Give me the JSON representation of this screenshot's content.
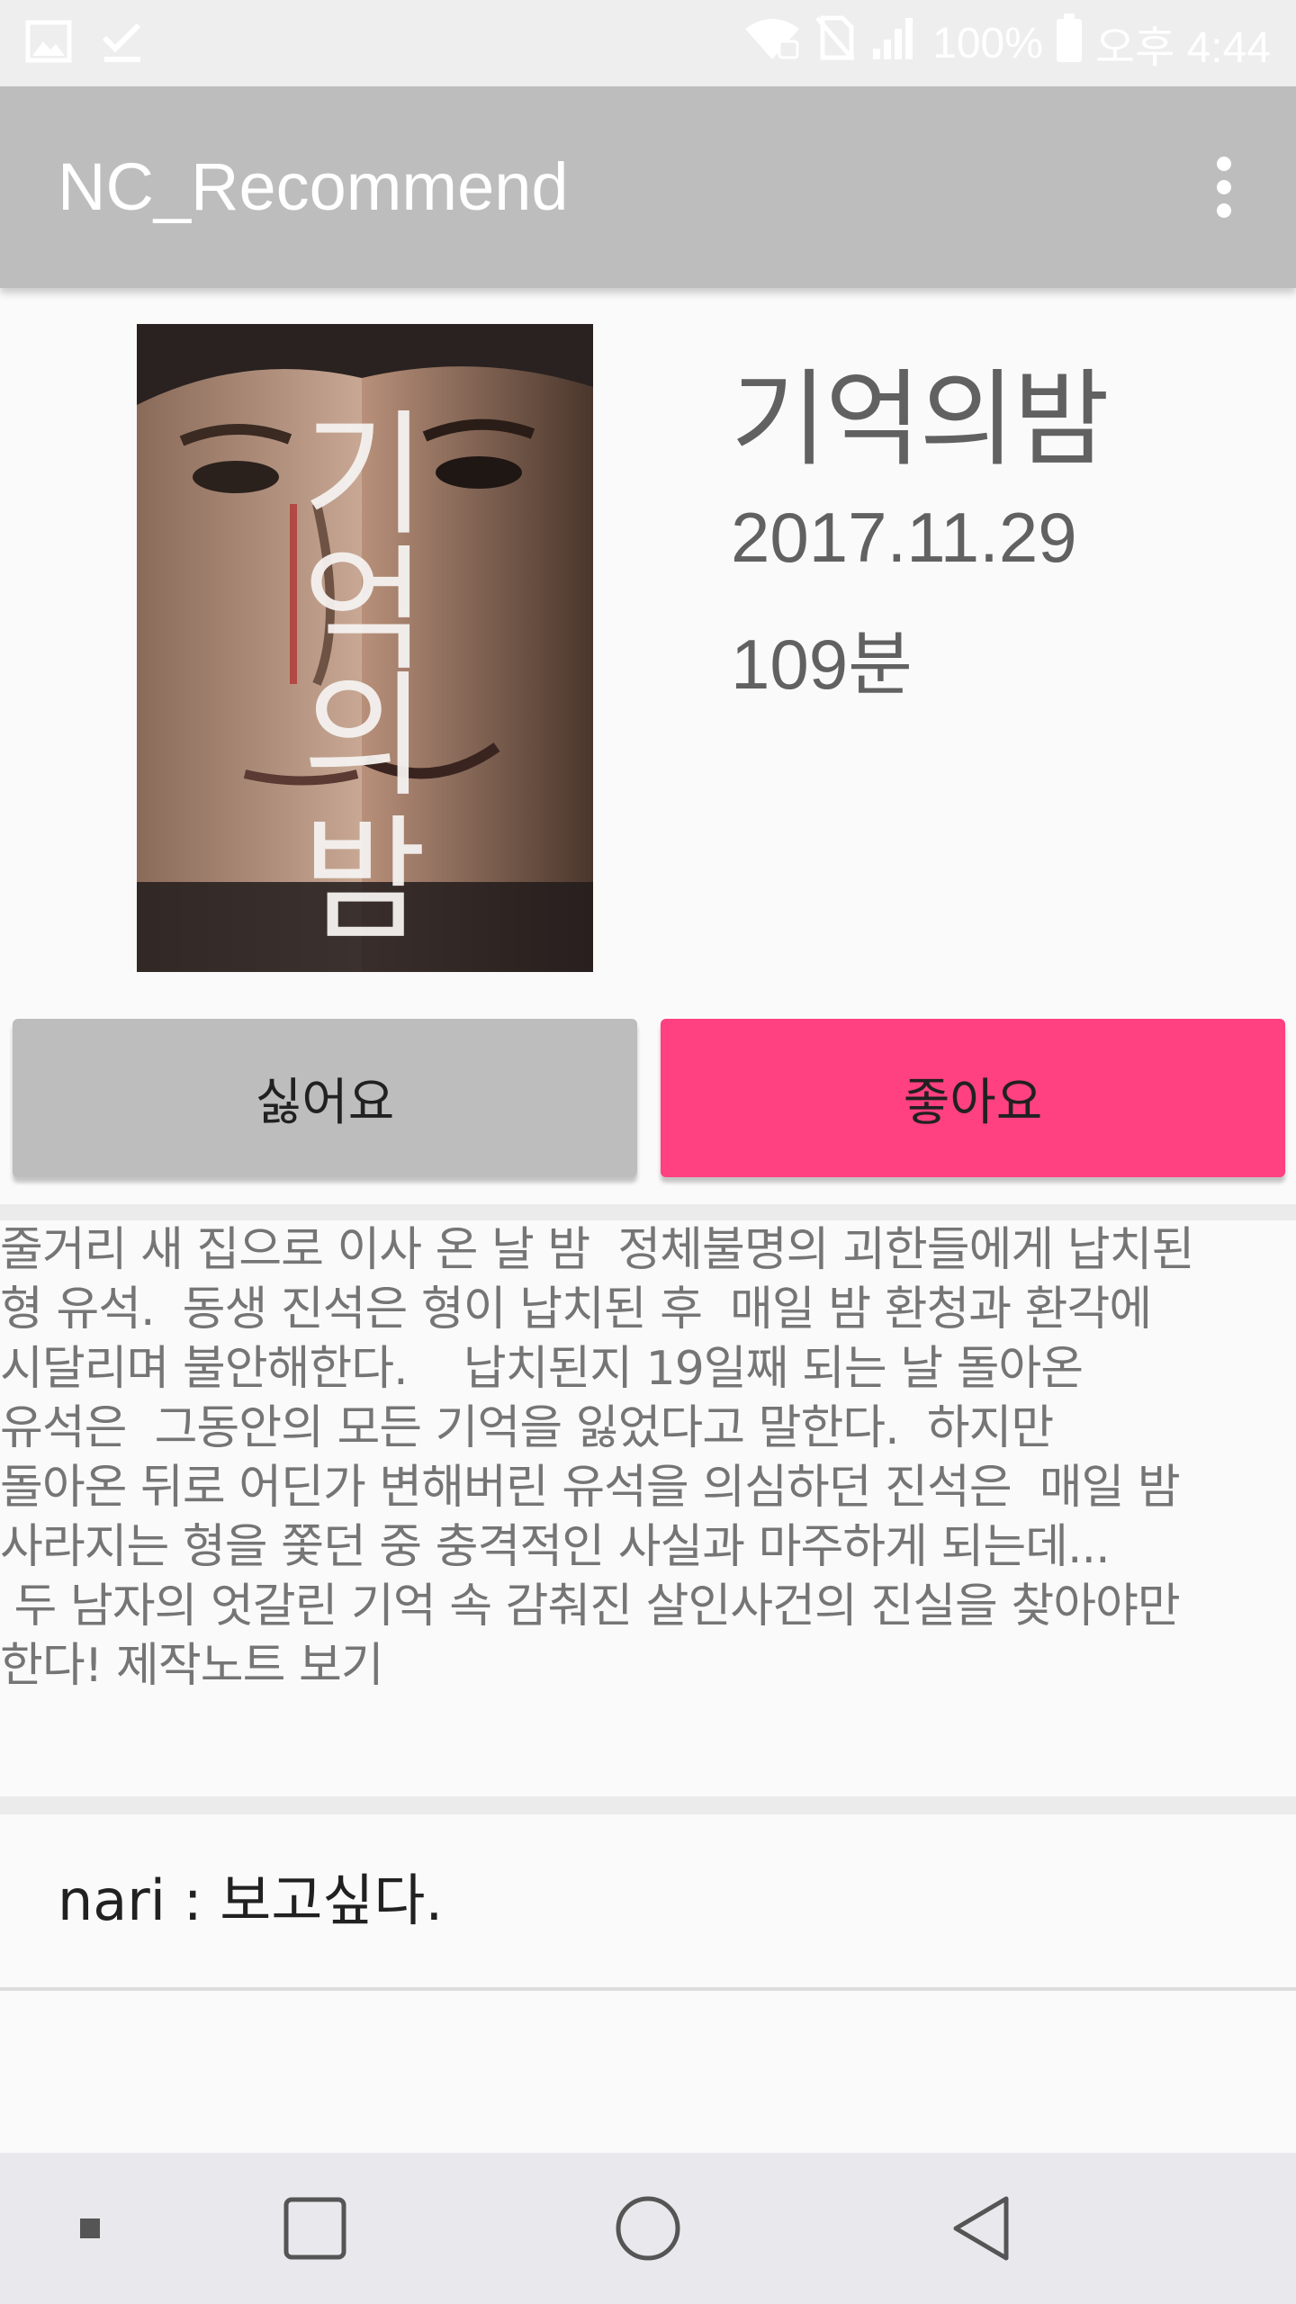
{
  "status_bar": {
    "left_icons": [
      "image-icon",
      "check-icon"
    ],
    "right_icons": [
      "wifi-icon",
      "no-sim-icon",
      "signal-icon",
      "battery-icon"
    ],
    "battery": "100%",
    "time": "오후 4:44"
  },
  "app_bar": {
    "title": "NC_Recommend",
    "menu_icon": "more-vert-icon"
  },
  "movie": {
    "title": "기억의밤",
    "release_date": "2017.11.29",
    "runtime": "109분",
    "poster_title_text": "기억의밤"
  },
  "buttons": {
    "dislike_label": "싫어요",
    "like_label": "좋아요"
  },
  "description": "줄거리 새 집으로 이사 온 날 밤  정체불명의 괴한들에게 납치된\n형 유석.  동생 진석은 형이 납치된 후  매일 밤 환청과 환각에\n시달리며 불안해한다.    납치된지 19일째 되는 날 돌아온\n유석은  그동안의 모든 기억을 잃었다고 말한다.  하지만\n돌아온 뒤로 어딘가 변해버린 유석을 의심하던 진석은  매일 밤\n사라지는 형을 쫓던 중 충격적인 사실과 마주하게 되는데...\n 두 남자의 엇갈린 기억 속 감춰진 살인사건의 진실을 찾아야만\n한다! 제작노트 보기",
  "comments": [
    {
      "text": "nari : 보고싶다."
    }
  ],
  "nav_bar": {
    "items": [
      "square-small-icon",
      "recents-icon",
      "home-icon",
      "back-icon"
    ]
  },
  "colors": {
    "app_bar": "#bdbdbd",
    "like_button": "#ff4081",
    "dislike_button": "#bdbdbd",
    "background": "#fafafa"
  }
}
